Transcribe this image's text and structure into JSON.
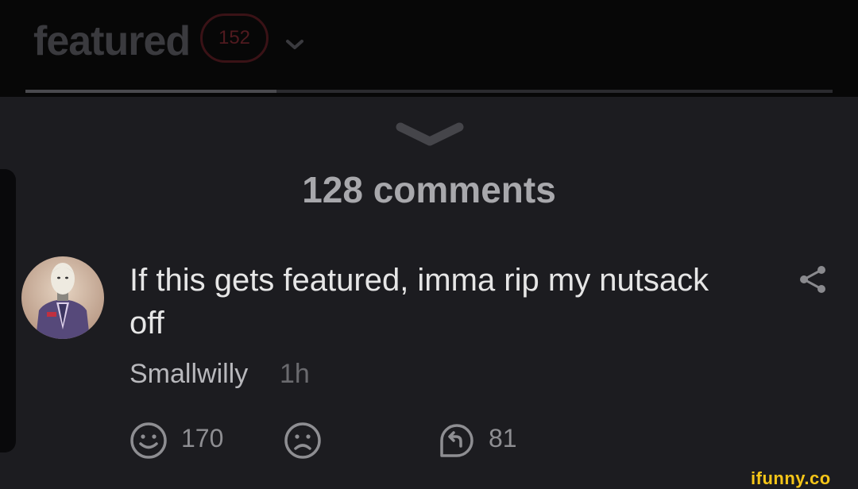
{
  "header": {
    "feed_title": "featured",
    "feed_count": "152"
  },
  "comments_header": {
    "count_label": "128 comments"
  },
  "comment": {
    "text": "If this gets featured, imma rip my nutsack off",
    "author": "Smallwilly",
    "time_ago": "1h",
    "smile_count": "170",
    "reply_count": "81"
  },
  "icons": {
    "feed_dropdown": "chevron-down-icon",
    "collapse": "chevron-down-icon",
    "share": "share-icon",
    "smile": "smile-icon",
    "unsmile": "frown-icon",
    "reply": "reply-icon"
  },
  "watermark": "ifunny.co",
  "colors": {
    "background": "#1c1c20",
    "topbar": "#070707",
    "badge": "#501a1f",
    "watermark": "#f5c518"
  }
}
